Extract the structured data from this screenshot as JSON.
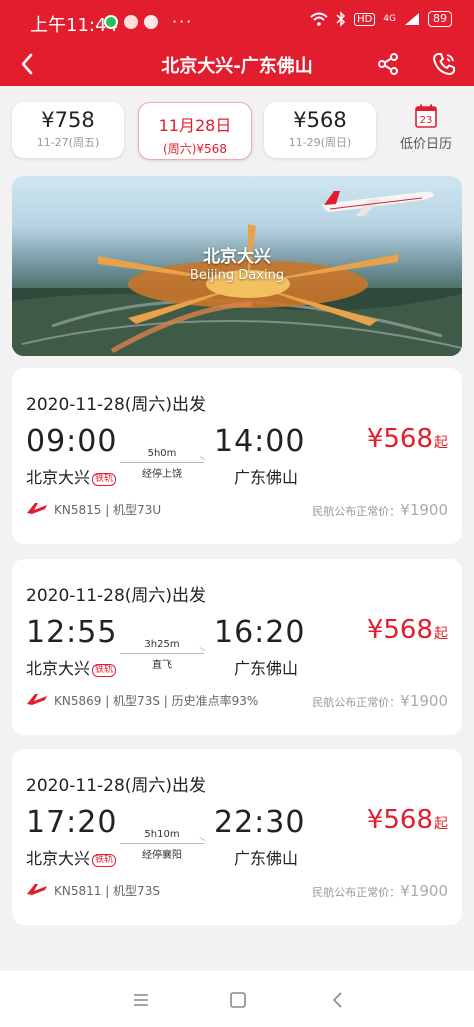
{
  "status": {
    "time": "上午11:44",
    "more": "···",
    "hd": "HD",
    "signal": "4G",
    "battery": "89"
  },
  "nav": {
    "title": "北京大兴-广东佛山"
  },
  "date_strip": {
    "prev": {
      "price": "¥758",
      "sub": "11-27(周五)"
    },
    "current": {
      "date": "11月28日",
      "sub": "(周六)¥568"
    },
    "next": {
      "price": "¥568",
      "sub": "11-29(周日)"
    },
    "calendar": {
      "day": "23",
      "label": "低价日历"
    }
  },
  "banner": {
    "name_cn": "北京大兴",
    "name_en": "Beijing Daxing"
  },
  "flights": [
    {
      "date_line": "2020-11-28(周六)出发",
      "dep_time": "09:00",
      "arr_time": "14:00",
      "duration": "5h0m",
      "stop": "经停上饶",
      "dep_city": "北京大兴",
      "tag": "铁轨",
      "arr_city": "广东佛山",
      "price": "¥568",
      "price_suffix": "起",
      "flight_info": "KN5815 | 机型73U",
      "ref_label": "民航公布正常价：",
      "ref_price": "¥1900"
    },
    {
      "date_line": "2020-11-28(周六)出发",
      "dep_time": "12:55",
      "arr_time": "16:20",
      "duration": "3h25m",
      "stop": "直飞",
      "dep_city": "北京大兴",
      "tag": "铁轨",
      "arr_city": "广东佛山",
      "price": "¥568",
      "price_suffix": "起",
      "flight_info": "KN5869 | 机型73S | 历史准点率93%",
      "ref_label": "民航公布正常价：",
      "ref_price": "¥1900"
    },
    {
      "date_line": "2020-11-28(周六)出发",
      "dep_time": "17:20",
      "arr_time": "22:30",
      "duration": "5h10m",
      "stop": "经停襄阳",
      "dep_city": "北京大兴",
      "tag": "铁轨",
      "arr_city": "广东佛山",
      "price": "¥568",
      "price_suffix": "起",
      "flight_info": "KN5811 | 机型73S",
      "ref_label": "民航公布正常价：",
      "ref_price": "¥1900"
    }
  ],
  "colors": {
    "brand": "#e21d2e",
    "page_bg": "#f2f2f2"
  },
  "icons": {
    "back": "chevron-left-icon",
    "share": "share-icon",
    "phone": "phone-icon",
    "calendar": "calendar-icon",
    "airline": "airline-logo-icon"
  }
}
